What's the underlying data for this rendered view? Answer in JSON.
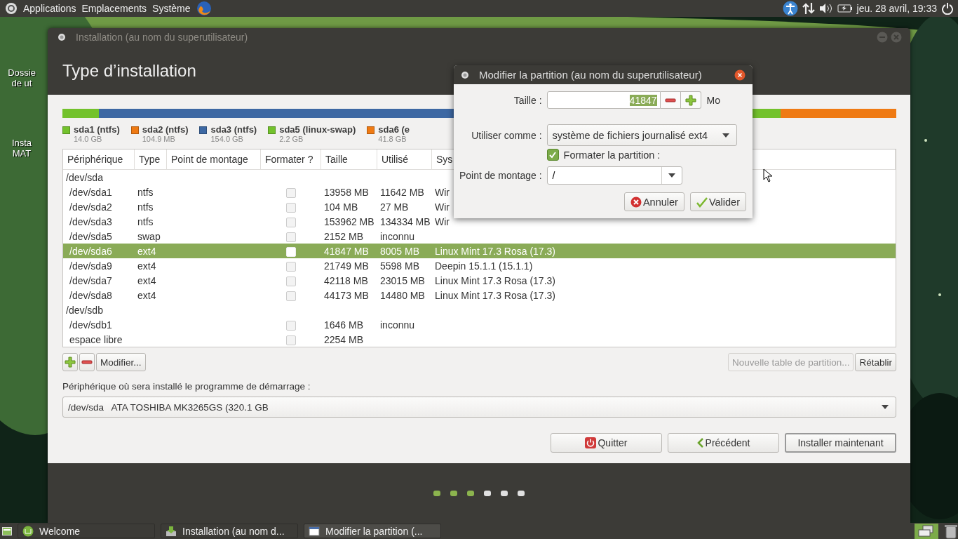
{
  "top_panel": {
    "menus": [
      "Applications",
      "Emplacements",
      "Système"
    ],
    "clock": "jeu. 28 avril, 19:33"
  },
  "desktop_icons": [
    {
      "lines": [
        "Dossie",
        "de ut"
      ]
    },
    {
      "lines": [
        "Insta",
        "MAT"
      ]
    }
  ],
  "main_window": {
    "title": "Installation (au nom du superutilisateur)",
    "heading": "Type d’installation",
    "legend": [
      {
        "name": "sda1 (ntfs)",
        "size": "14.0 GB",
        "color": "#73c22c"
      },
      {
        "name": "sda2 (ntfs)",
        "size": "104.9 MB",
        "color": "#ef7a13"
      },
      {
        "name": "sda3 (ntfs)",
        "size": "154.0 GB",
        "color": "#3d68a3"
      },
      {
        "name": "sda5 (linux-swap)",
        "size": "2.2 GB",
        "color": "#73c22c"
      },
      {
        "name": "sda6 (e",
        "size": "41.8 GB",
        "color": "#ef7a13"
      }
    ],
    "table": {
      "columns": [
        "Périphérique",
        "Type",
        "Point de montage",
        "Formater ?",
        "Taille",
        "Utilisé",
        "Sys"
      ],
      "rows": [
        {
          "device": "/dev/sda",
          "children": [
            {
              "device": "/dev/sda1",
              "type": "ntfs",
              "format": false,
              "size": "13958 MB",
              "used": "11642 MB",
              "system": "Wir",
              "selected": false
            },
            {
              "device": "/dev/sda2",
              "type": "ntfs",
              "format": false,
              "size": "104 MB",
              "used": "27 MB",
              "system": "Wir",
              "selected": false
            },
            {
              "device": "/dev/sda3",
              "type": "ntfs",
              "format": false,
              "size": "153962 MB",
              "used": "134334 MB",
              "system": "Wir",
              "selected": false
            },
            {
              "device": "/dev/sda5",
              "type": "swap",
              "format": false,
              "size": "2152 MB",
              "used": "inconnu",
              "selected": false
            },
            {
              "device": "/dev/sda6",
              "type": "ext4",
              "format": false,
              "size": "41847 MB",
              "used": "8005 MB",
              "system": "Linux Mint 17.3 Rosa (17.3)",
              "selected": true
            },
            {
              "device": "/dev/sda9",
              "type": "ext4",
              "format": false,
              "size": "21749 MB",
              "used": "5598 MB",
              "system": "Deepin 15.1.1  (15.1.1)",
              "selected": false
            },
            {
              "device": "/dev/sda7",
              "type": "ext4",
              "format": false,
              "size": "42118 MB",
              "used": "23015 MB",
              "system": "Linux Mint 17.3 Rosa (17.3)",
              "selected": false
            },
            {
              "device": "/dev/sda8",
              "type": "ext4",
              "format": false,
              "size": "44173 MB",
              "used": "14480 MB",
              "system": "Linux Mint 17.3 Rosa (17.3)",
              "selected": false
            }
          ]
        },
        {
          "device": "/dev/sdb",
          "children": [
            {
              "device": "/dev/sdb1",
              "format": false,
              "size": "1646 MB",
              "used": "inconnu",
              "selected": false
            },
            {
              "device": "espace libre",
              "format": false,
              "size": "2254 MB",
              "selected": false
            }
          ]
        }
      ]
    },
    "table_buttons": {
      "modify": "Modifier...",
      "new_table": {
        "label": "Nouvelle table de partition...",
        "disabled": true
      },
      "revert": {
        "label": "Rétablir",
        "disabled": false
      }
    },
    "boot_label": "Périphérique où sera installé le programme de démarrage :",
    "boot_device": "/dev/sda   ATA TOSHIBA MK3265GS (320.1 GB",
    "buttons": [
      {
        "kind": "quit",
        "label": "Quitter",
        "default": false
      },
      {
        "kind": "back",
        "label": "Précédent",
        "default": false
      },
      {
        "kind": "plain",
        "label": "Installer maintenant",
        "default": true
      }
    ],
    "steps": [
      {
        "done": true
      },
      {
        "done": true
      },
      {
        "done": true
      },
      {
        "done": false
      },
      {
        "done": false
      },
      {
        "done": false
      }
    ]
  },
  "dialog": {
    "title": "Modifier la partition (au nom du superutilisateur)",
    "size_label": "Taille :",
    "size_value": "41847",
    "size_unit": "Mo",
    "use_label": "Utiliser comme :",
    "use_value": "système de fichiers journalisé ext4",
    "format": {
      "label": "Formater la partition :",
      "checked": true
    },
    "mount_label": "Point de montage :",
    "mount_value": "/",
    "cancel": "Annuler",
    "ok": "Valider"
  },
  "taskbar": {
    "tasks": [
      {
        "label": "Welcome",
        "kind": "welcome",
        "selected": false
      },
      {
        "label": "Installation (au nom d...",
        "kind": "installer",
        "selected": false
      },
      {
        "label": "Modifier la partition (...",
        "kind": "window",
        "selected": true
      }
    ]
  }
}
